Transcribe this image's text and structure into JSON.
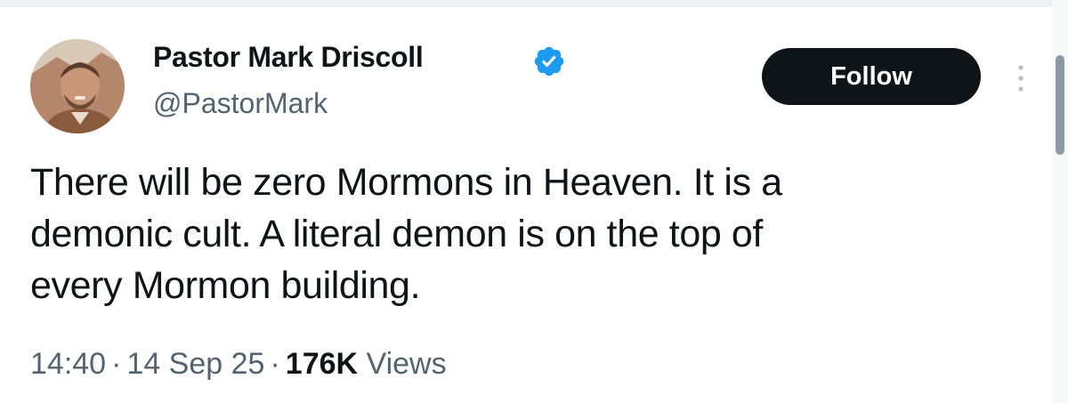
{
  "author": {
    "display_name": "Pastor Mark Driscoll",
    "handle": "@PastorMark",
    "verified_icon": "verified-badge-icon",
    "avatar_icon": "profile-avatar"
  },
  "actions": {
    "follow_label": "Follow",
    "more_icon": "more-options-icon"
  },
  "tweet": {
    "lines": [
      "There will be zero Mormons in Heaven. It is a",
      "demonic cult. A literal demon is on the top of",
      "every Mormon building."
    ]
  },
  "meta": {
    "time": "14:40",
    "separator": "·",
    "date": "14 Sep 25",
    "views_count": "176K",
    "views_label": "Views"
  },
  "colors": {
    "text_primary": "#0f1419",
    "text_secondary": "#536471",
    "verified": "#1d9bf0",
    "button_bg": "#0f1419",
    "button_text": "#ffffff"
  }
}
